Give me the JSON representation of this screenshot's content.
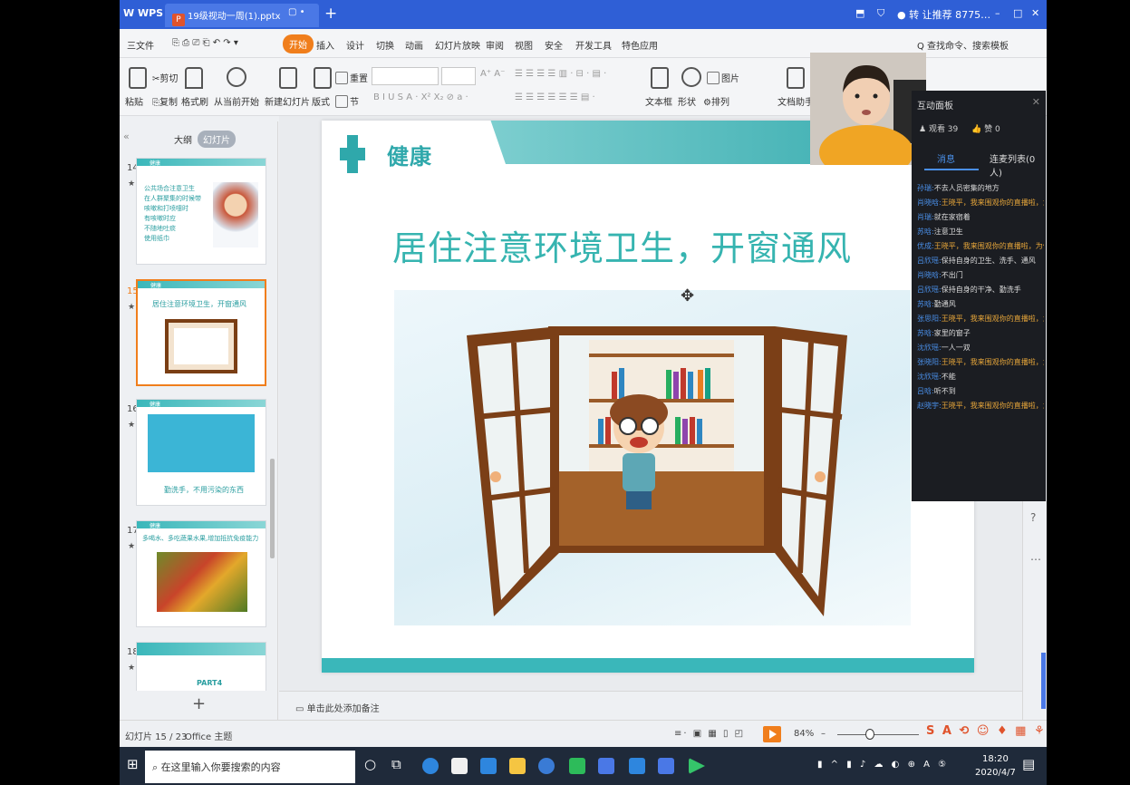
{
  "titlebar": {
    "app": "W WPS",
    "doc_tab": "19级视动一周(1).pptx",
    "right_items": [
      "转 让推荐",
      "8775…"
    ],
    "min": "–",
    "max": "□",
    "close": "✕"
  },
  "menubar": {
    "file": "三文件",
    "items": [
      "开始",
      "插入",
      "设计",
      "切换",
      "动画",
      "幻灯片放映",
      "审阅",
      "视图",
      "安全",
      "开发工具",
      "特色应用"
    ],
    "search": "Q 查找命令、搜索模板"
  },
  "ribbon": {
    "paste": "粘贴",
    "cut": "剪切",
    "copy": "复制",
    "format_painter": "格式刷",
    "from_current": "从当前开始",
    "new_slide": "新建幻灯片",
    "layout": "版式",
    "reset": "重置",
    "section": "节",
    "text_box": "文本框",
    "shape": "形状",
    "picture": "图片",
    "arrange": "排列",
    "doc_helper": "文档助手"
  },
  "left_panel": {
    "tab_outline": "大纲",
    "tab_slides": "幻灯片",
    "thumbs": [
      {
        "num": "14",
        "head": "健康",
        "lines": [
          "公共场合注意卫生",
          "在人群聚集的时候带",
          "咳嗽和打喷嚏时",
          "有咳嗽时应",
          "不随地吐痰",
          "使用纸巾"
        ]
      },
      {
        "num": "15",
        "head": "健康",
        "lines": [
          "居住注意环境卫生，开窗通风"
        ]
      },
      {
        "num": "16",
        "head": "健康",
        "lines": [
          "勤洗手，不用污染的东西"
        ]
      },
      {
        "num": "17",
        "head": "健康",
        "lines": [
          "多喝水、多吃蔬果水果,增加抵抗免疫能力"
        ]
      },
      {
        "num": "18",
        "head": "",
        "lines": [
          "PART4"
        ]
      }
    ],
    "add": "+"
  },
  "slide": {
    "header": "健康",
    "title": "居住注意环境卫生，开窗通风"
  },
  "notes": {
    "placeholder": "单击此处添加备注"
  },
  "status": {
    "slide_info": "幻灯片 15 / 23",
    "theme": "Office 主题",
    "zoom": "84%"
  },
  "taskbar": {
    "search": "在这里输入你要搜索的内容",
    "time": "18:20",
    "date": "2020/4/7"
  },
  "chat": {
    "title": "互动面板",
    "viewers": "观看 39",
    "likes": "赞 0",
    "tab_messages": "消息",
    "tab_mic": "连麦列表(0人)",
    "messages": [
      {
        "user": "孙瑞:",
        "text": "不去人员密集的地方",
        "warn": false
      },
      {
        "user": "肖晓晗:",
        "text": "王晓平，我来围观你的直播啦，为你点赞!",
        "warn": true
      },
      {
        "user": "肖瑞:",
        "text": "就在家宿着",
        "warn": false
      },
      {
        "user": "苏晗:",
        "text": "注意卫生",
        "warn": false
      },
      {
        "user": "优成:",
        "text": "王晓平，我来围观你的直播啦，为你点赞!",
        "warn": true
      },
      {
        "user": "吕欣瑶:",
        "text": "保持自身的卫生、洗手、通风",
        "warn": false
      },
      {
        "user": "肖晓晗:",
        "text": "不出门",
        "warn": false
      },
      {
        "user": "吕欣瑶:",
        "text": "保持自身的干净、勤洗手",
        "warn": false
      },
      {
        "user": "苏晗:",
        "text": "勤通风",
        "warn": false
      },
      {
        "user": "张思阳:",
        "text": "王晓平，我来围观你的直播啦，为你点赞!",
        "warn": true
      },
      {
        "user": "苏晗:",
        "text": "家里的窗子",
        "warn": false
      },
      {
        "user": "沈欣瑶:",
        "text": "一人一双",
        "warn": false
      },
      {
        "user": "张晓阳:",
        "text": "王晓平，我来围观你的直播啦，为你点赞!",
        "warn": true
      },
      {
        "user": "沈欣瑶:",
        "text": "不能",
        "warn": false
      },
      {
        "user": "吕晗:",
        "text": "听不到",
        "warn": false
      },
      {
        "user": "赵晓宇:",
        "text": "王晓平，我来围观你的直播啦，为你点赞!",
        "warn": true
      }
    ]
  }
}
